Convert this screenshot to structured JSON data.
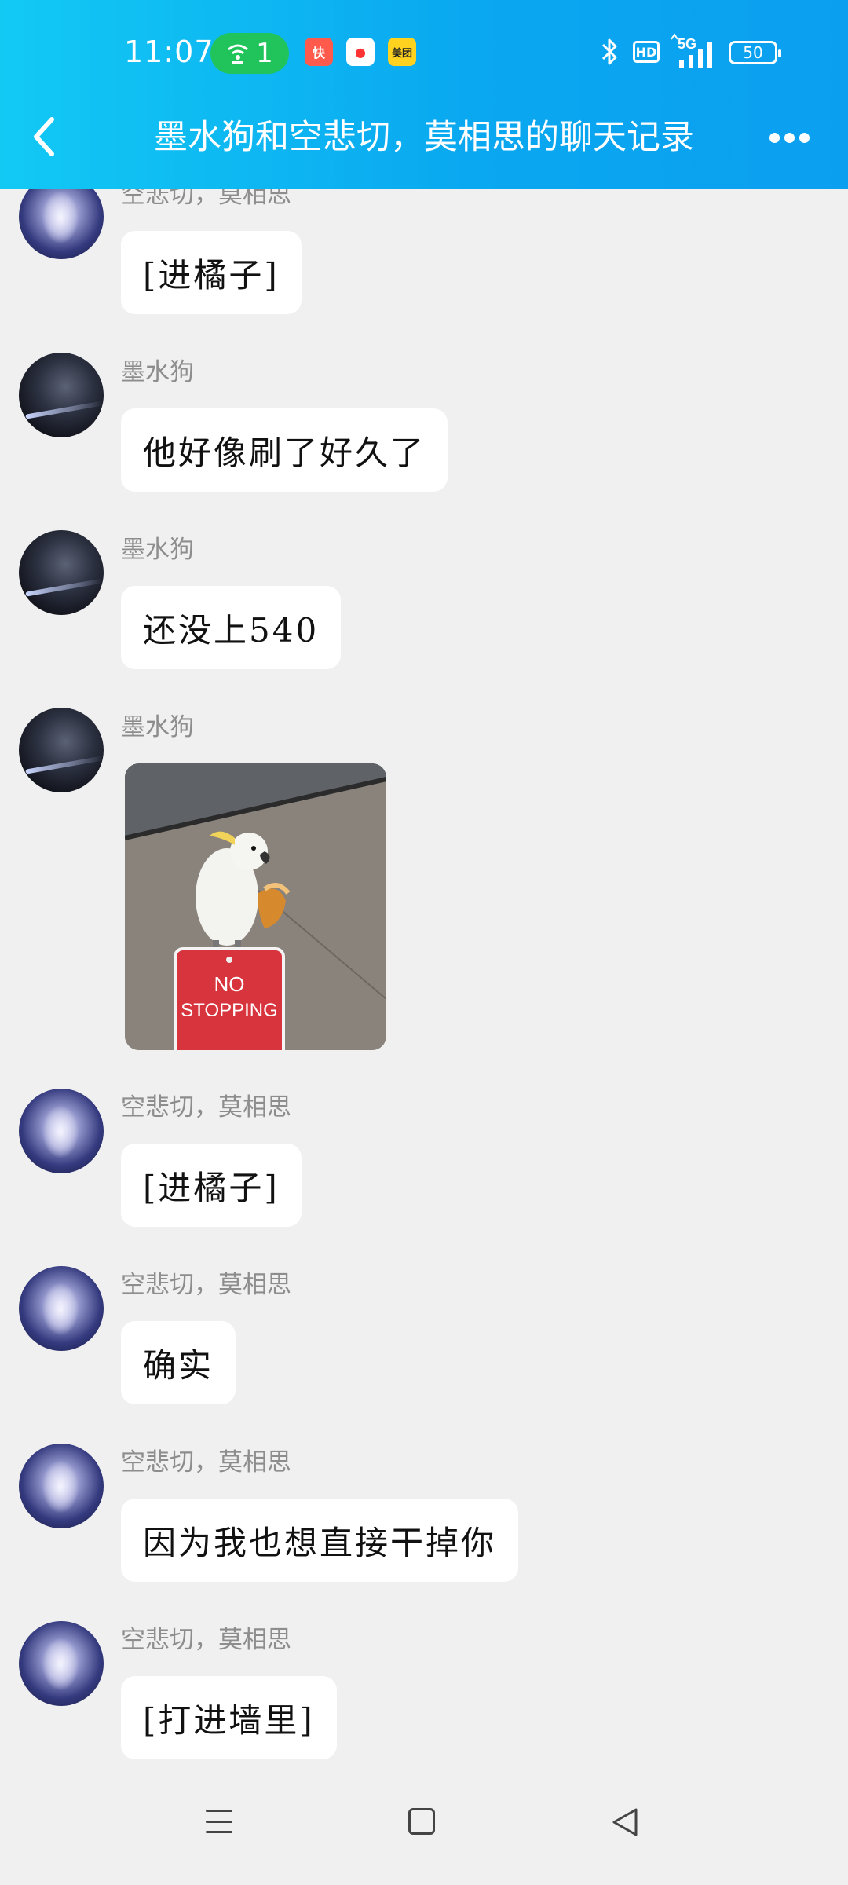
{
  "status_bar": {
    "time": "11:07",
    "hotspot_count": "1",
    "app_icons": [
      "kuaishou-app",
      "maps-app",
      "美团"
    ],
    "hd_label": "HD",
    "network": "5G",
    "battery": "50"
  },
  "header": {
    "title": "墨水狗和空悲切，莫相思的聊天记录",
    "accent_color": "#0aa8f0"
  },
  "messages": [
    {
      "sender": "空悲切，莫相思",
      "type": "text",
      "text": "[进橘子]",
      "avatar": "silver-angel-avatar"
    },
    {
      "sender": "墨水狗",
      "type": "text",
      "text": "他好像刷了好久了",
      "avatar": "dark-warrior-avatar"
    },
    {
      "sender": "墨水狗",
      "type": "text",
      "text": "还没上540",
      "avatar": "dark-warrior-avatar"
    },
    {
      "sender": "墨水狗",
      "type": "image",
      "image_text_line1": "NO",
      "image_text_line2": "STOPPING",
      "avatar": "dark-warrior-avatar"
    },
    {
      "sender": "空悲切，莫相思",
      "type": "text",
      "text": "[进橘子]",
      "avatar": "silver-angel-avatar"
    },
    {
      "sender": "空悲切，莫相思",
      "type": "text",
      "text": "确实",
      "avatar": "silver-angel-avatar"
    },
    {
      "sender": "空悲切，莫相思",
      "type": "text",
      "text": "因为我也想直接干掉你",
      "avatar": "silver-angel-avatar"
    },
    {
      "sender": "空悲切，莫相思",
      "type": "text",
      "text": "[打进墙里]",
      "avatar": "silver-angel-avatar"
    }
  ],
  "nav_bar": {
    "buttons": [
      "menu-icon",
      "home-icon",
      "back-icon"
    ]
  }
}
